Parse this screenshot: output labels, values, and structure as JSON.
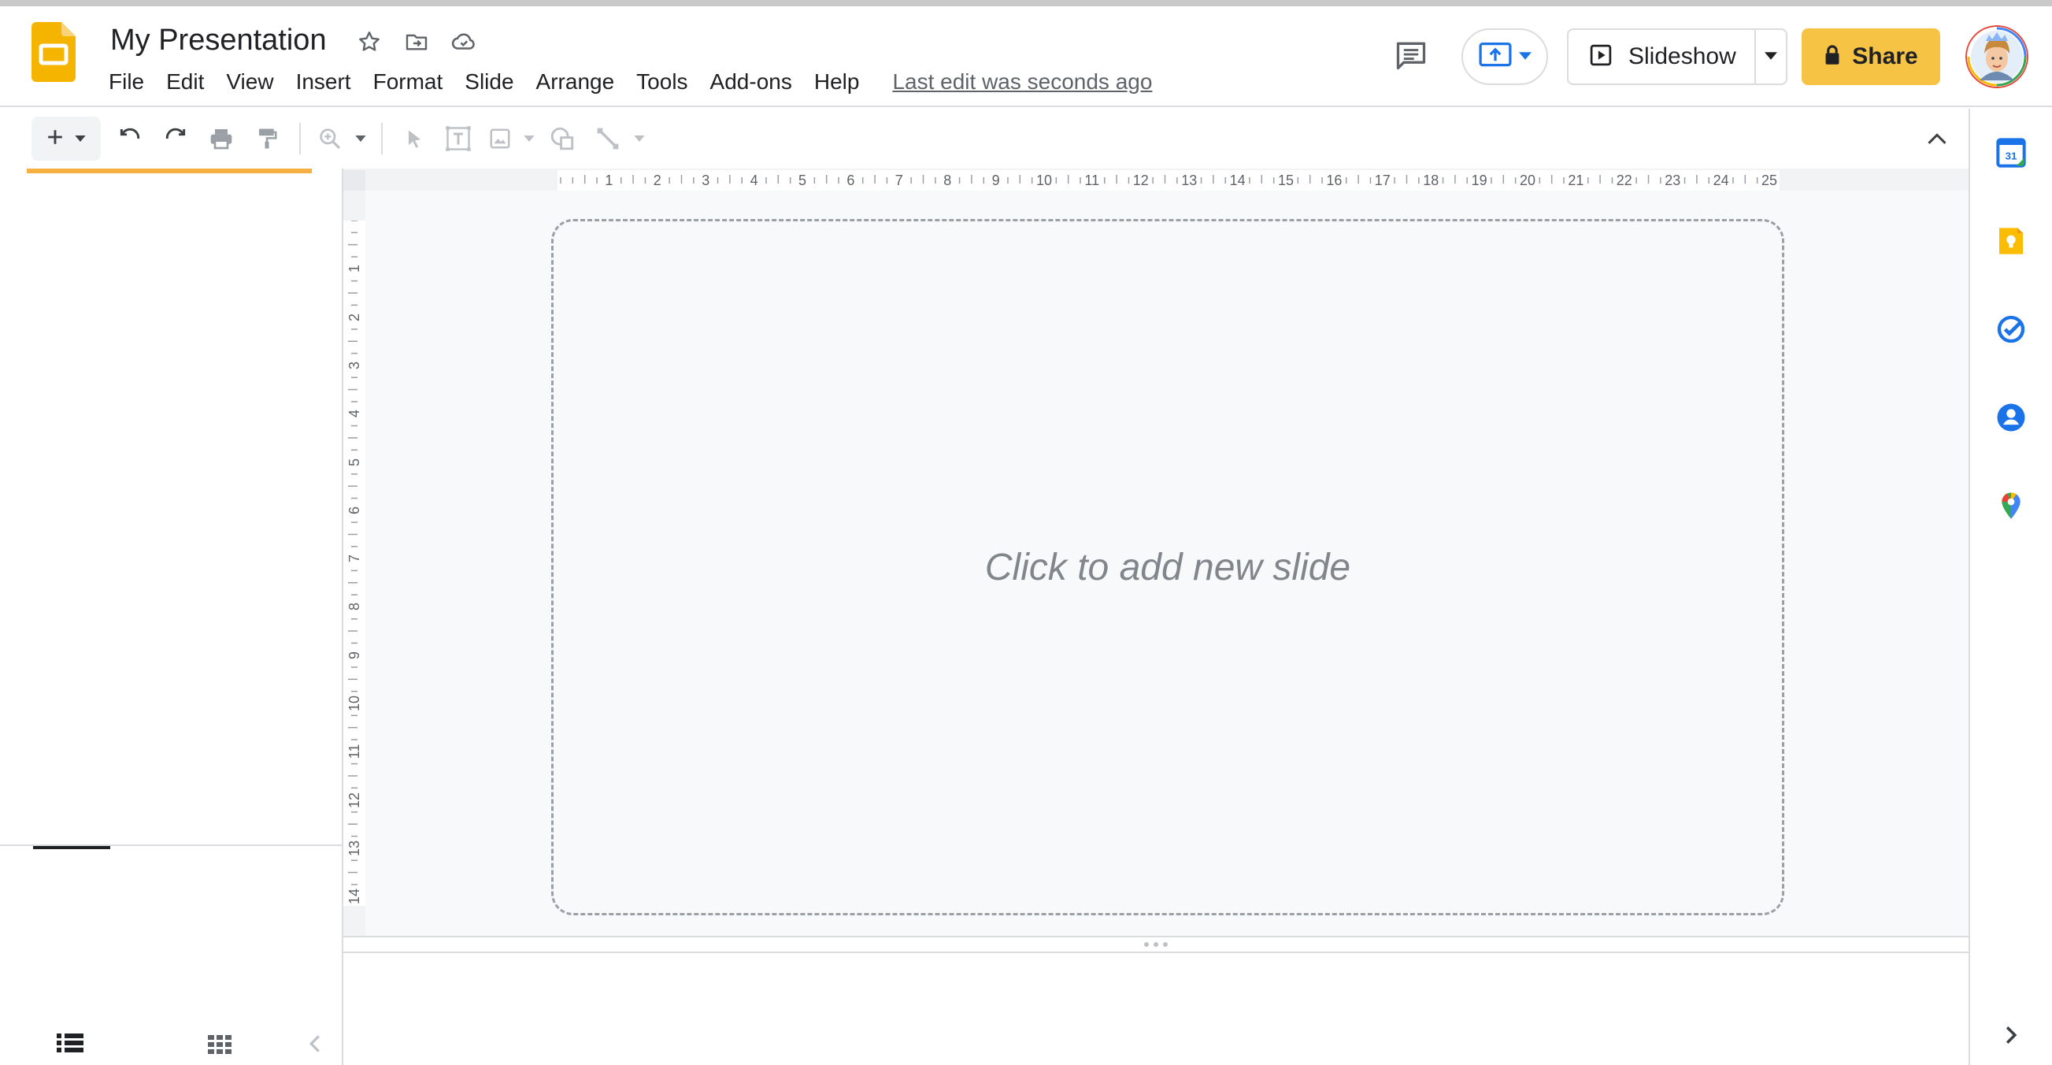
{
  "document": {
    "title": "My Presentation",
    "last_edit": "Last edit was seconds ago"
  },
  "menu": [
    "File",
    "Edit",
    "View",
    "Insert",
    "Format",
    "Slide",
    "Arrange",
    "Tools",
    "Add-ons",
    "Help"
  ],
  "header_icons": {
    "star": "star-icon",
    "move": "move-to-folder-icon",
    "cloud": "cloud-saved-icon",
    "comments": "comments-icon",
    "present": "present-to-meeting-icon"
  },
  "buttons": {
    "slideshow": "Slideshow",
    "share": "Share"
  },
  "toolbar": {
    "icons": [
      "new-slide-icon",
      "new-slide-dropdown-icon",
      "undo-icon",
      "redo-icon",
      "print-icon",
      "paint-format-icon",
      "zoom-icon",
      "zoom-dropdown-icon",
      "select-icon",
      "text-box-icon",
      "image-icon",
      "image-dropdown-icon",
      "shape-icon",
      "line-icon",
      "line-dropdown-icon"
    ]
  },
  "ruler": {
    "top": [
      "1",
      "2",
      "3",
      "4",
      "5",
      "6",
      "7",
      "8",
      "9",
      "10",
      "11",
      "12",
      "13",
      "14",
      "15",
      "16",
      "17",
      "18",
      "19",
      "20",
      "21",
      "22",
      "23",
      "24",
      "25"
    ],
    "left": [
      "1",
      "2",
      "3",
      "4",
      "5",
      "6",
      "7",
      "8",
      "9",
      "10",
      "11",
      "12",
      "13",
      "14"
    ]
  },
  "canvas": {
    "placeholder": "Click to add new slide"
  },
  "side_panel": {
    "apps": [
      "calendar-icon",
      "keep-icon",
      "tasks-icon",
      "contacts-icon",
      "maps-icon"
    ],
    "expand": "chevron-right-icon"
  },
  "colors": {
    "accent": "#f6c344",
    "filmstrip_indicator": "#f6b041",
    "calendar_blue": "#1a73e8",
    "keep_yellow": "#fbbc04"
  }
}
